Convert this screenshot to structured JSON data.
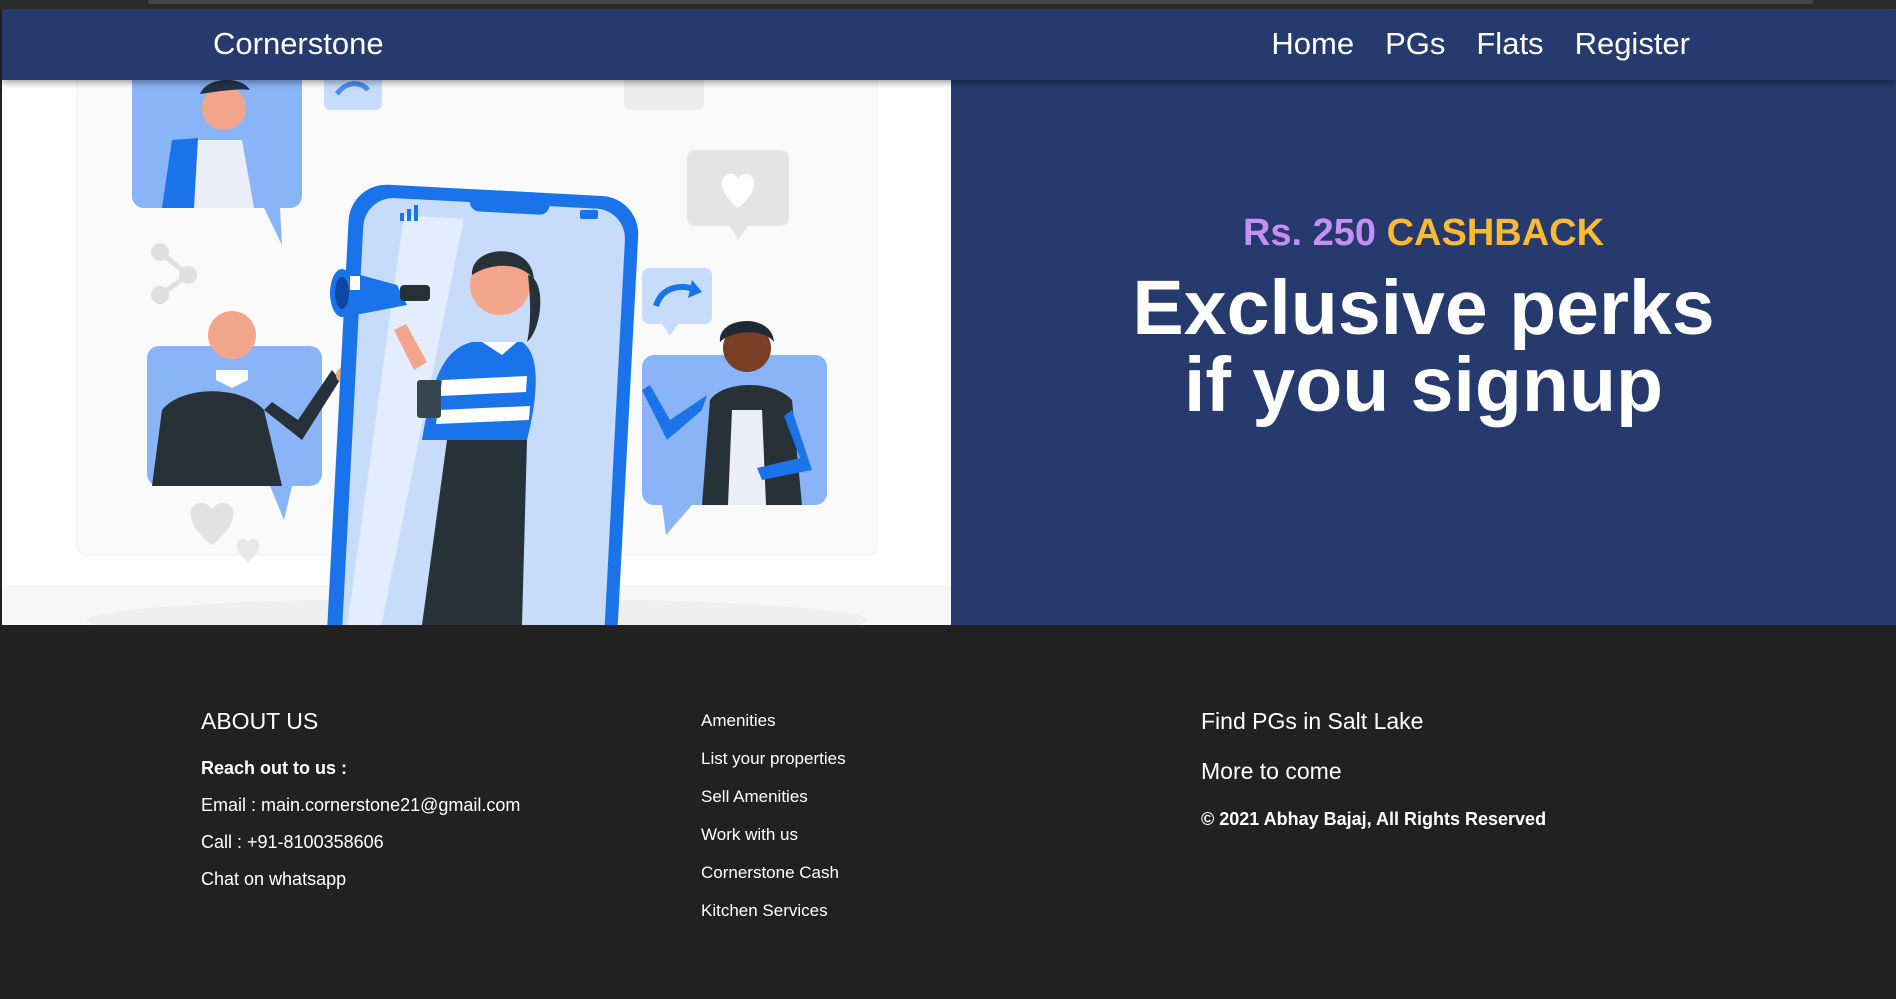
{
  "nav": {
    "brand": "Cornerstone",
    "links": [
      "Home",
      "PGs",
      "Flats",
      "Register"
    ]
  },
  "hero": {
    "cashback_amount": "Rs. 250",
    "cashback_word": "CASHBACK",
    "headline_line1": "Exclusive perks",
    "headline_line2": "if you signup"
  },
  "footer": {
    "about_title": "ABOUT US",
    "reach": "Reach out to us :",
    "email": "Email : main.cornerstone21@gmail.com",
    "call": "Call : +91-8100358606",
    "whatsapp": "Chat on whatsapp",
    "links": [
      "Amenities",
      "List your properties",
      "Sell Amenities",
      "Work with us",
      "Cornerstone Cash",
      "Kitchen Services"
    ],
    "find_pgs": "Find PGs in Salt Lake",
    "more": "More to come",
    "copyright": "© 2021 Abhay Bajaj,   All Rights Reserved"
  },
  "colors": {
    "navbar": "#263a6d",
    "cashback_amount": "#c490f5",
    "cashback_word": "#fcb934",
    "footer": "#212121",
    "illustration_blue": "#2f80ed"
  }
}
